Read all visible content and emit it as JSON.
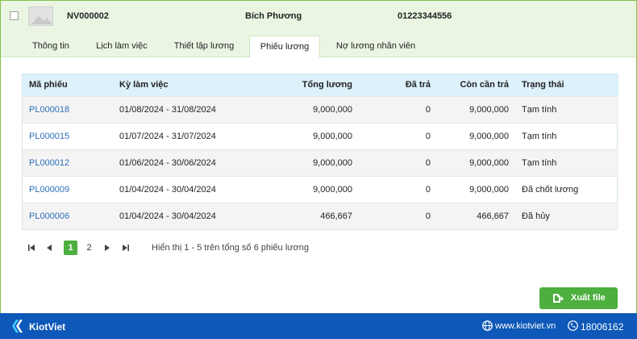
{
  "employee": {
    "code": "NV000002",
    "name": "Bích Phương",
    "phone": "01223344556"
  },
  "tabs": [
    {
      "label": "Thông tin",
      "active": false
    },
    {
      "label": "Lịch làm việc",
      "active": false
    },
    {
      "label": "Thiết lập lương",
      "active": false
    },
    {
      "label": "Phiếu lương",
      "active": true
    },
    {
      "label": "Nợ lương nhân viên",
      "active": false
    }
  ],
  "table": {
    "columns": [
      "Mã phiếu",
      "Kỳ làm việc",
      "Tổng lương",
      "Đã trả",
      "Còn cần trả",
      "Trạng thái"
    ],
    "rows": [
      {
        "code": "PL000018",
        "period": "01/08/2024 - 31/08/2024",
        "total": "9,000,000",
        "paid": "0",
        "remaining": "9,000,000",
        "status": "Tạm tính"
      },
      {
        "code": "PL000015",
        "period": "01/07/2024 - 31/07/2024",
        "total": "9,000,000",
        "paid": "0",
        "remaining": "9,000,000",
        "status": "Tạm tính"
      },
      {
        "code": "PL000012",
        "period": "01/06/2024 - 30/06/2024",
        "total": "9,000,000",
        "paid": "0",
        "remaining": "9,000,000",
        "status": "Tạm tính"
      },
      {
        "code": "PL000009",
        "period": "01/04/2024 - 30/04/2024",
        "total": "9,000,000",
        "paid": "0",
        "remaining": "9,000,000",
        "status": "Đã chốt lương"
      },
      {
        "code": "PL000006",
        "period": "01/04/2024 - 30/04/2024",
        "total": "466,667",
        "paid": "0",
        "remaining": "466,667",
        "status": "Đã hủy"
      }
    ]
  },
  "pagination": {
    "pages": [
      "1",
      "2"
    ],
    "current_page": "1",
    "info": "Hiển thị 1 - 5 trên tổng số 6 phiếu lương"
  },
  "actions": {
    "export_label": "Xuất file"
  },
  "footer": {
    "brand": "KiotViet",
    "website": "www.kiotviet.vn",
    "hotline": "18006162"
  },
  "colors": {
    "accent_green": "#4caf3e",
    "header_green": "#eaf6e3",
    "table_header": "#ddf1fb",
    "link_blue": "#2c6fb8",
    "footer_blue": "#0d58b8"
  }
}
